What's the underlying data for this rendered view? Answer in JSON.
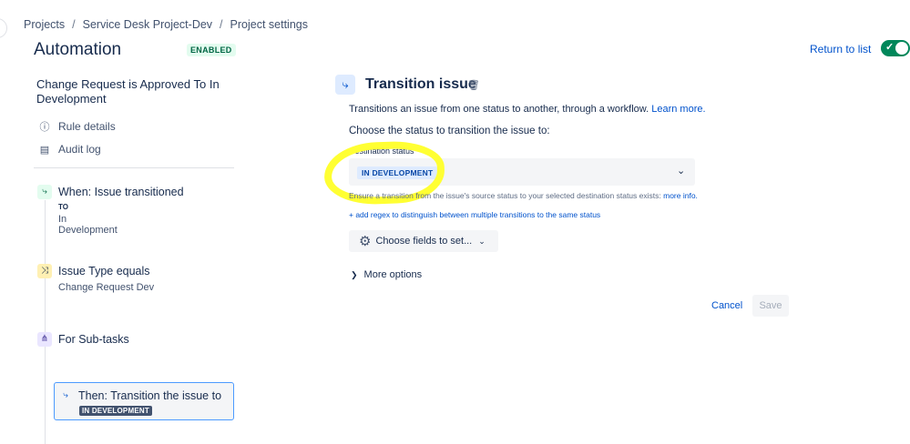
{
  "breadcrumb": {
    "items": [
      "Projects",
      "Service Desk Project-Dev",
      "Project settings"
    ],
    "separator": "/"
  },
  "header": {
    "title": "Automation",
    "status_badge": "ENABLED",
    "return_label": "Return to list",
    "toggle_on": true
  },
  "sidebar": {
    "rule_name": "Change Request is Approved To In Development",
    "links": [
      {
        "label": "Rule details",
        "icon": "info-icon"
      },
      {
        "label": "Audit log",
        "icon": "document-icon"
      }
    ],
    "trigger": {
      "title": "When: Issue transitioned",
      "label": "TO",
      "value": "In Development",
      "icon": "transition-icon",
      "color": "#e3fcef"
    },
    "condition": {
      "title": "Issue Type equals",
      "value": "Change Request Dev",
      "icon": "shuffle-icon",
      "color": "#fff0b3"
    },
    "branch": {
      "title": "For Sub-tasks",
      "icon": "hierarchy-icon",
      "color": "#eae6ff"
    },
    "action": {
      "title": "Then: Transition the issue to",
      "badge": "IN DEVELOPMENT",
      "icon": "transition-icon"
    }
  },
  "panel": {
    "title": "Transition issue",
    "description": "Transitions an issue from one status to another, through a workflow.",
    "learn_more": "Learn more.",
    "choose_prompt": "Choose the status to transition the issue to:",
    "destination_label": "Destination status",
    "destination_value": "IN DEVELOPMENT",
    "hint": "Ensure a transition from the issue's source status to your selected destination status exists:",
    "hint_link": "more info.",
    "regex_link": "+ add regex to distinguish between multiple transitions to the same status",
    "fields_button": "Choose fields to set...",
    "more_options": "More options",
    "cancel_label": "Cancel",
    "save_label": "Save"
  },
  "colors": {
    "accent": "#0052cc",
    "toggle": "#00875a",
    "highlight": "#ffff33"
  }
}
